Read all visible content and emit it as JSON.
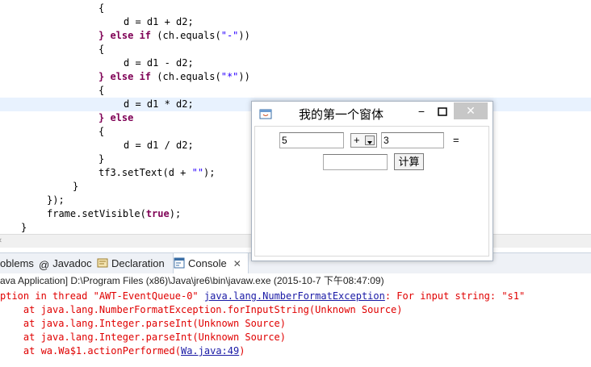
{
  "editor": {
    "lines": [
      {
        "text": "{"
      },
      {
        "text": "d = d1 + d2;"
      },
      {
        "kw": "} else if ",
        "pre": "(ch.equals(",
        "str": "\"-\"",
        "post": "))"
      },
      {
        "text": "{"
      },
      {
        "text": "d = d1 - d2;"
      },
      {
        "kw": "} else if ",
        "pre": "(ch.equals(",
        "str": "\"*\"",
        "post": "))"
      },
      {
        "text": "{"
      },
      {
        "text": "d = d1 * d2;"
      },
      {
        "kw": "} else"
      },
      {
        "text": "{"
      },
      {
        "text": "d = d1 / d2;"
      },
      {
        "text": "}"
      },
      {
        "pre": "tf3.setText(d + ",
        "str": "\"\"",
        "post": ");"
      },
      {
        "text": "}"
      },
      {
        "text": "});"
      },
      {
        "pre": "frame.setVisible(",
        "kw": "true",
        "post": ");"
      },
      {
        "text": "}"
      }
    ]
  },
  "tabs": {
    "problems": "oblems",
    "javadoc": "Javadoc",
    "declaration": "Declaration",
    "console": "Console",
    "close": "✕"
  },
  "console": {
    "header": "ava Application] D:\\Program Files (x86)\\Java\\jre6\\bin\\javaw.exe (2015-10-7 下午08:47:09)",
    "l1_pre": "ption in thread \"AWT-EventQueue-0\" ",
    "l1_link": "java.lang.NumberFormatException",
    "l1_post": ": For input string: \"s1\"",
    "l2": "    at java.lang.NumberFormatException.forInputString(Unknown Source)",
    "l3": "    at java.lang.Integer.parseInt(Unknown Source)",
    "l4": "    at java.lang.Integer.parseInt(Unknown Source)",
    "l5_pre": "    at wa.Wa$1.actionPerformed(",
    "l5_link": "Wa.java:49",
    "l5_post": ")"
  },
  "swing": {
    "title": "我的第一个窗体",
    "min": "−",
    "close": "✕",
    "tf1": "5",
    "op": "+",
    "tf2": "3",
    "eq": "=",
    "tf3": "",
    "calc": "计算"
  }
}
